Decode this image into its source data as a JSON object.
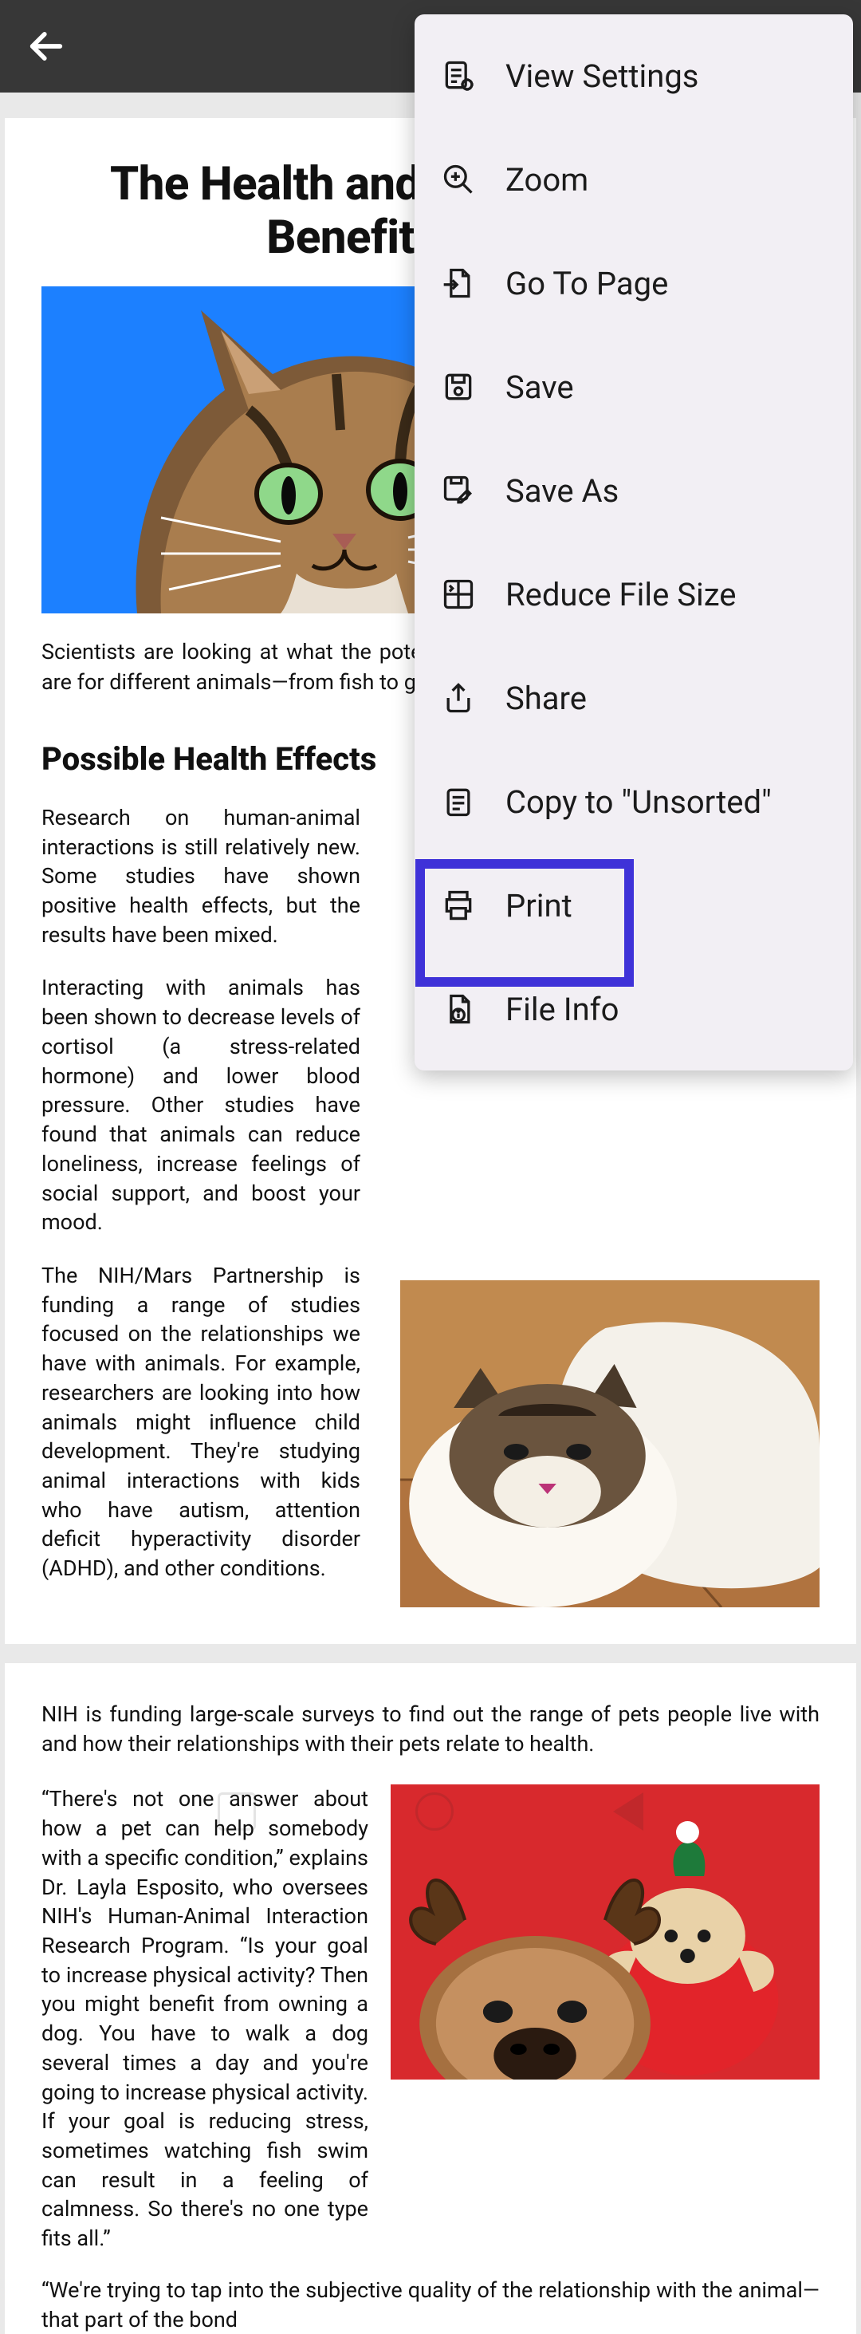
{
  "menu": {
    "items": [
      {
        "label": "View Settings"
      },
      {
        "label": "Zoom"
      },
      {
        "label": "Go To Page"
      },
      {
        "label": "Save"
      },
      {
        "label": "Save As"
      },
      {
        "label": "Reduce File Size"
      },
      {
        "label": "Share"
      },
      {
        "label": "Copy to \"Unsorted\""
      },
      {
        "label": "Print"
      },
      {
        "label": "File Info"
      }
    ]
  },
  "doc": {
    "title_line1": "The Health and Mood-Boosting",
    "title_line2": "Benefits of Pets",
    "intro": "Scientists are looking at what the potential physical and mental health benefits are for different animals—from fish to guinea pigs to dogs and cats.",
    "section1_heading": "Possible Health Effects",
    "p1": "Research on human-animal interactions is still relatively new. Some studies have shown positive health effects, but the results have been mixed.",
    "p2": "Interacting with animals has been shown to decrease levels of cortisol (a stress-related hormone) and lower blood pressure. Other studies have found that animals can reduce loneliness, increase feelings of social support, and boost your mood.",
    "p3": "The NIH/Mars Partnership is funding a range of studies focused on the relationships we have with animals. For example, researchers are looking into how animals might influence child development. They're studying animal interactions with kids who have autism, attention deficit hyperactivity disorder (ADHD), and other conditions.",
    "page2_p1": "NIH is funding large-scale surveys to find out the range of pets people live with and how their relationships with their pets relate to health.",
    "page2_p2": "“There's not one answer about how a pet can help somebody with a specific condition,” explains Dr. Layla Esposito, who oversees NIH's Human-Animal Interaction Research Program. “Is your goal to increase physical activity? Then you might benefit from owning a dog. You have to walk a dog several times a day and you're going to increase physical activity. If your goal is reducing stress, sometimes watching fish swim can result in a feeling of calmness. So there's no one type fits all.”",
    "page2_tail": "“We're trying to tap into the subjective quality of the relationship with the animal—that part of the bond"
  }
}
